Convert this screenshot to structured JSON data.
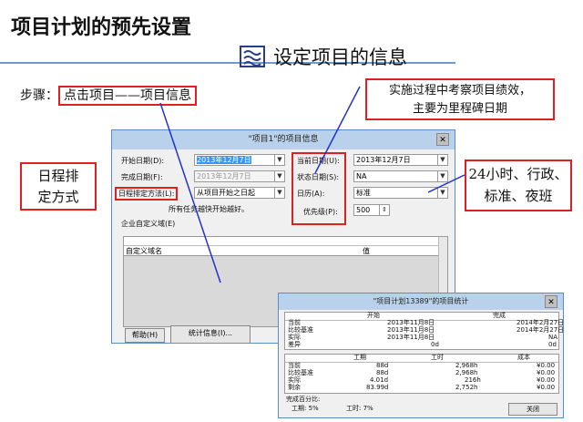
{
  "slide": {
    "title": "项目计划的预先设置",
    "subtitle": "设定项目的信息",
    "step_label": "步骤：",
    "step_action": "点击项目——项目信息"
  },
  "callouts": {
    "top_right": [
      "实施过程中考察项目绩效，",
      "主要为里程碑日期"
    ],
    "left": [
      "日程排",
      "定方式"
    ],
    "right": [
      "24小时、行政、",
      "标准、夜班"
    ]
  },
  "colors": {
    "accent": "#e02020",
    "title_line": "#6b9bd1",
    "dialog_title": "#b9d1ea"
  },
  "dialog": {
    "title": "\"项目1\"的项目信息",
    "close": "✕",
    "start_date": {
      "label": "开始日期(D):",
      "value": "2013年12月7日"
    },
    "finish_date": {
      "label": "完成日期(F):",
      "value": "2013年12月7日"
    },
    "schedule_from": {
      "label": "日程排定方法(L):",
      "value": "从项目开始之日起"
    },
    "schedule_note": "所有任务越快开始越好。",
    "current_date": {
      "label": "当前日期(U):",
      "value": "2013年12月7日"
    },
    "status_date": {
      "label": "状态日期(S):",
      "value": "NA"
    },
    "calendar": {
      "label": "日历(A):",
      "value": "标准"
    },
    "priority": {
      "label": "优先级(P):",
      "value": "500"
    },
    "custom_fields_label": "企业自定义域(E)",
    "grid_headers": [
      "自定义域名",
      "值"
    ],
    "help_button": "帮助(H)",
    "stats_button": "统计信息(I)..."
  },
  "stats_dialog": {
    "title": "\"项目计划13389\"的项目统计",
    "close": "✕",
    "top_headers": [
      "开始",
      "完成"
    ],
    "top_rows": [
      {
        "label": "当前",
        "start": "2013年11月8日",
        "finish": "2014年2月27日"
      },
      {
        "label": "比较基准",
        "start": "2013年11月8日",
        "finish": "2014年2月27日"
      },
      {
        "label": "实际",
        "start": "2013年11月8日",
        "finish": "NA"
      },
      {
        "label": "差异",
        "start": "0d",
        "finish": "0d"
      }
    ],
    "bottom_headers": [
      "工期",
      "工时",
      "成本"
    ],
    "bottom_rows": [
      {
        "label": "当前",
        "duration": "88d",
        "work": "2,968h",
        "cost": "¥0.00"
      },
      {
        "label": "比较基准",
        "duration": "88d",
        "work": "2,968h",
        "cost": "¥0.00"
      },
      {
        "label": "实际",
        "duration": "4.01d",
        "work": "216h",
        "cost": "¥0.00"
      },
      {
        "label": "剩余",
        "duration": "83.99d",
        "work": "2,752h",
        "cost": "¥0.00"
      }
    ],
    "percent_label": "完成百分比:",
    "duration_pct": "工期:   5%",
    "work_pct": "工时:   7%",
    "close_button": "关闭"
  }
}
